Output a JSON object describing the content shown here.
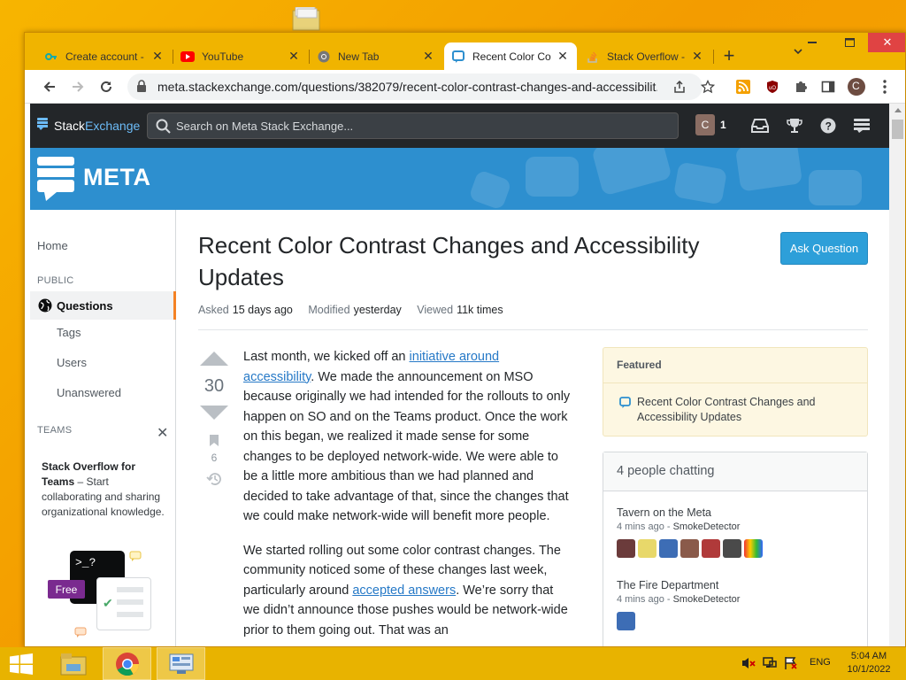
{
  "browser": {
    "tabs": [
      {
        "label": "Create account -",
        "icon": "key-icon"
      },
      {
        "label": "YouTube",
        "icon": "youtube-icon"
      },
      {
        "label": "New Tab",
        "icon": "chrome-icon"
      },
      {
        "label": "Recent Color Co",
        "icon": "meta-chat-icon",
        "active": true
      },
      {
        "label": "Stack Overflow -",
        "icon": "stackoverflow-icon"
      }
    ],
    "url": "meta.stackexchange.com/questions/382079/recent-color-contrast-changes-and-accessibilit...",
    "profile_initial": "C"
  },
  "site": {
    "logo_part1": "Stack",
    "logo_part2": "Exchange",
    "search_placeholder": "Search on Meta Stack Exchange...",
    "avatar_initial": "C",
    "reputation": "1",
    "banner_title": "META"
  },
  "sidebar": {
    "home": "Home",
    "public_label": "PUBLIC",
    "questions": "Questions",
    "tags": "Tags",
    "users": "Users",
    "unanswered": "Unanswered",
    "teams_label": "TEAMS",
    "teams_title": "Stack Overflow for Teams",
    "teams_text": " – Start collaborating and sharing organizational knowledge.",
    "free_badge": "Free",
    "terminal_text": ">_?"
  },
  "question": {
    "title": "Recent Color Contrast Changes and Accessibility Updates",
    "ask_button": "Ask Question",
    "asked_label": "Asked",
    "asked_value": "15 days ago",
    "modified_label": "Modified",
    "modified_value": "yesterday",
    "viewed_label": "Viewed",
    "viewed_value": "11k times",
    "votes": "30",
    "bookmarks": "6",
    "p1_a": "Last month, we kicked off an ",
    "p1_link": "initiative around accessibility",
    "p1_b": ". We made the announcement on MSO because originally we had intended for the rollouts to only happen on SO and on the Teams product. Once the work on this began, we realized it made sense for some changes to be deployed network-wide. We were able to be a little more ambitious than we had planned and decided to take advantage of that, since the changes that we could make network-wide will benefit more people.",
    "p2_a": "We started rolling out some color contrast changes. The community noticed some of these changes last week, particularly around ",
    "p2_link": "accepted answers",
    "p2_b": ". We’re sorry that we didn’t announce those pushes would be network-wide prior to them going out. That was an"
  },
  "featured": {
    "heading": "Featured",
    "item": "Recent Color Contrast Changes and Accessibility Updates"
  },
  "chat": {
    "heading": "4 people chatting",
    "rooms": [
      {
        "name": "Tavern on the Meta",
        "time": "4 mins ago",
        "sep": " - ",
        "who": "SmokeDetector"
      },
      {
        "name": "The Fire Department",
        "time": "4 mins ago",
        "sep": " - ",
        "who": "SmokeDetector"
      }
    ]
  },
  "taskbar": {
    "language": "ENG",
    "time": "5:04 AM",
    "date": "10/1/2022"
  },
  "colors": {
    "se_topbar": "#232629",
    "meta_blue": "#2d8fcf",
    "accent_orange": "#f48225",
    "link": "#2679c7",
    "desktop": "#f5a700"
  }
}
